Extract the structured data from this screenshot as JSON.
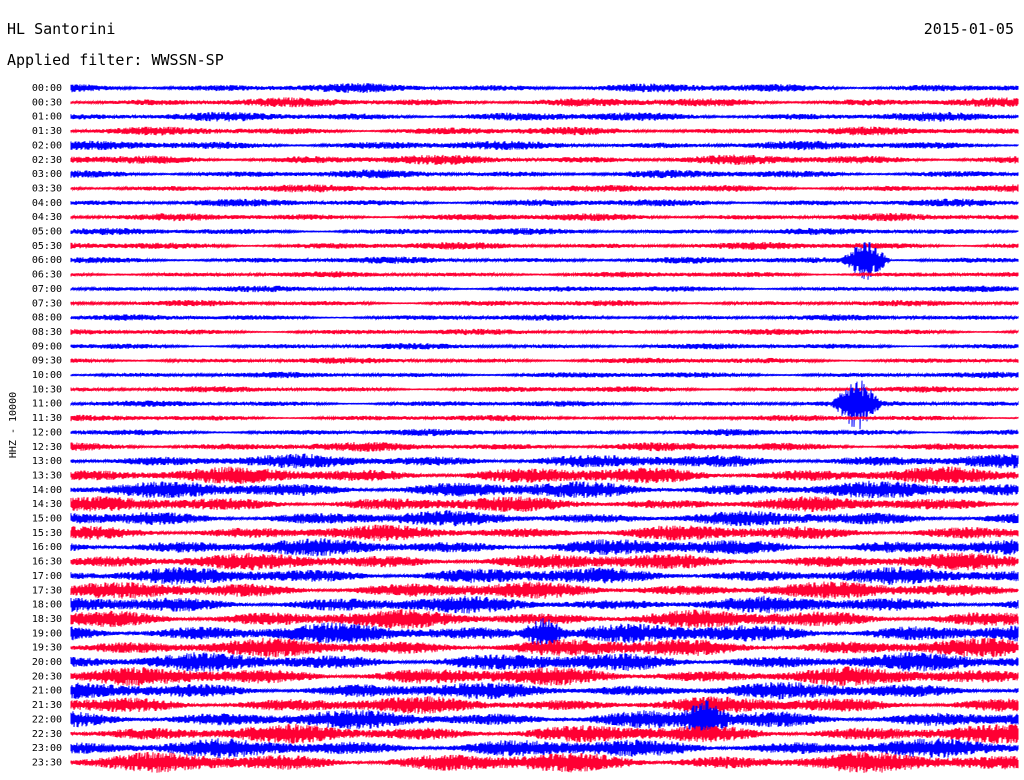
{
  "header": {
    "station": "HL Santorini",
    "date": "2015-01-05",
    "filter_label": "Applied filter: WWSSN-SP"
  },
  "chart_data": {
    "type": "line",
    "subtype": "helicorder",
    "ylabel": "HHZ - 10000",
    "colors": [
      "#0000ff",
      "#ff0033"
    ],
    "row_labels": [
      "00:00",
      "00:30",
      "01:00",
      "01:30",
      "02:00",
      "02:30",
      "03:00",
      "03:30",
      "04:00",
      "04:30",
      "05:00",
      "05:30",
      "06:00",
      "06:30",
      "07:00",
      "07:30",
      "08:00",
      "08:30",
      "09:00",
      "09:30",
      "10:00",
      "10:30",
      "11:00",
      "11:30",
      "12:00",
      "12:30",
      "13:00",
      "13:30",
      "14:00",
      "14:30",
      "15:00",
      "15:30",
      "16:00",
      "16:30",
      "17:00",
      "17:30",
      "18:00",
      "18:30",
      "19:00",
      "19:30",
      "20:00",
      "20:30",
      "21:00",
      "21:30",
      "22:00",
      "22:30",
      "23:00",
      "23:30"
    ],
    "amplitude_by_row": [
      0.6,
      0.6,
      0.6,
      0.55,
      0.6,
      0.65,
      0.55,
      0.5,
      0.5,
      0.5,
      0.45,
      0.5,
      0.45,
      0.4,
      0.4,
      0.4,
      0.4,
      0.4,
      0.4,
      0.4,
      0.4,
      0.4,
      0.4,
      0.4,
      0.45,
      0.6,
      0.9,
      1.1,
      1.1,
      1.0,
      1.0,
      1.0,
      1.1,
      1.1,
      1.1,
      1.1,
      1.1,
      1.2,
      1.3,
      1.2,
      1.2,
      1.2,
      1.1,
      1.1,
      1.2,
      1.2,
      1.2,
      1.3
    ],
    "events": [
      {
        "row": 22,
        "time_fraction": 0.83,
        "amplitude": 3.0
      },
      {
        "row": 12,
        "time_fraction": 0.84,
        "amplitude": 2.5
      },
      {
        "row": 38,
        "time_fraction": 0.5,
        "amplitude": 2.0
      },
      {
        "row": 44,
        "time_fraction": 0.67,
        "amplitude": 2.0
      }
    ]
  }
}
